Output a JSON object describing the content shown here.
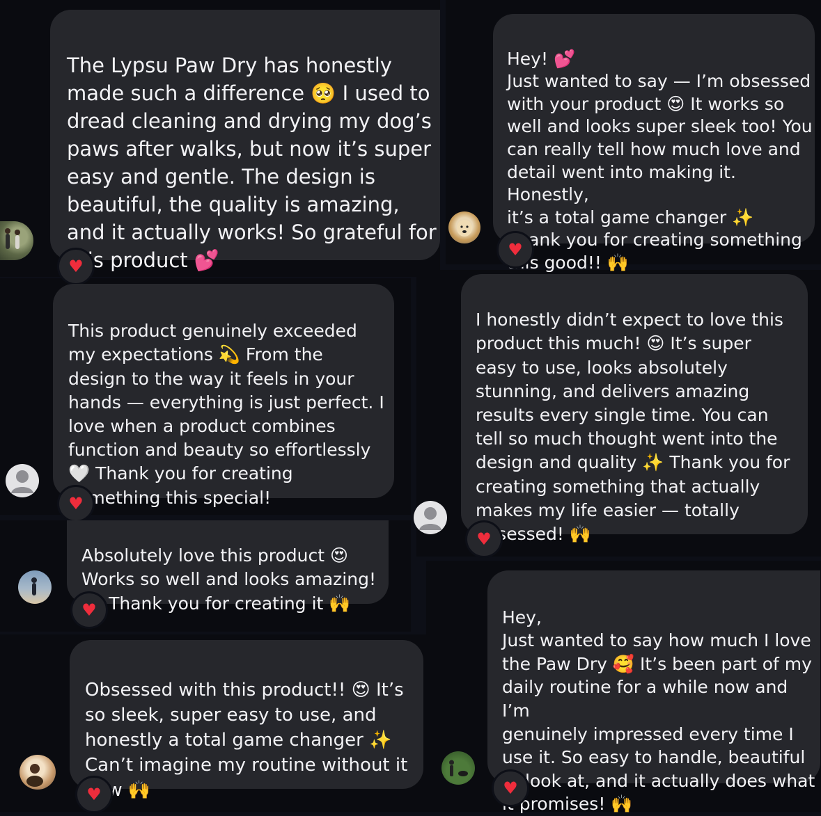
{
  "messages": [
    {
      "text": "The Lypsu Paw Dry has honestly\nmade such a difference 🥺 I used to\ndread cleaning and drying my dog’s\npaws after walks, but now it’s super\neasy and gentle. The design is\nbeautiful, the quality is amazing,\nand it actually works! So grateful for\nthis product 💕",
      "reaction": "heart-icon",
      "reaction_symbol": "♥",
      "avatar": "photo-people-walking"
    },
    {
      "text": "Hey! 💕\nJust wanted to say — I’m obsessed\nwith your product 😍 It works so\nwell and looks super sleek too! You\ncan really tell how much love and\ndetail went into making it. Honestly,\nit’s a total game changer ✨\nThank you for creating something\nthis good!! 🙌",
      "reaction": "heart-icon",
      "reaction_symbol": "♥",
      "avatar": "photo-golden-retriever"
    },
    {
      "text": "This product genuinely exceeded\nmy expectations 💫 From the\ndesign to the way it feels in your\nhands — everything is just perfect. I\nlove when a product combines\nfunction and beauty so effortlessly\n🤍 Thank you for creating\nsomething this special!",
      "reaction": "heart-icon",
      "reaction_symbol": "♥",
      "avatar": "default-avatar"
    },
    {
      "text": "I honestly didn’t expect to love this\nproduct this much! 😍 It’s super\neasy to use, looks absolutely\nstunning, and delivers amazing\nresults every single time. You can\ntell so much thought went into the\ndesign and quality ✨ Thank you for\ncreating something that actually\nmakes my life easier — totally\nobsessed! 🙌",
      "reaction": "heart-icon",
      "reaction_symbol": "♥",
      "avatar": "default-avatar"
    },
    {
      "text": "Absolutely love this product 😍\nWorks so well and looks amazing!\n✨ Thank you for creating it 🙌",
      "reaction": "heart-icon",
      "reaction_symbol": "♥",
      "avatar": "photo-beach-person"
    },
    {
      "text": "Hey,\nJust wanted to say how much I love\nthe Paw Dry 🥰 It’s been part of my\ndaily routine for a while now and I’m\ngenuinely impressed every time I\nuse it. So easy to handle, beautiful\nto look at, and it actually does what\nit promises! 🙌",
      "reaction": "heart-icon",
      "reaction_symbol": "♥",
      "avatar": "photo-park-dog"
    },
    {
      "text": "Obsessed with this product!! 😍 It’s\nso sleek, super easy to use, and\nhonestly a total game changer ✨\nCan’t imagine my routine without it\nnow 🙌",
      "reaction": "heart-icon",
      "reaction_symbol": "♥",
      "avatar": "photo-sunset-person"
    }
  ],
  "colors": {
    "background": "#0d0f17",
    "bubble": "#26272c",
    "text": "#f2f2f5",
    "heart": "#ef2d3c"
  }
}
